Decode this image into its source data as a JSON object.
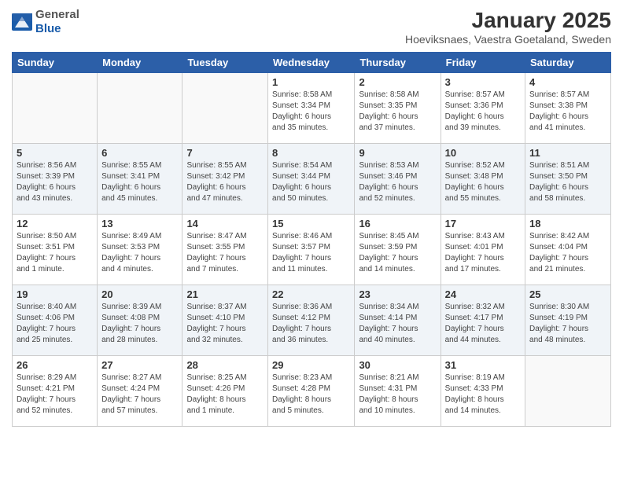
{
  "header": {
    "logo_general": "General",
    "logo_blue": "Blue",
    "title": "January 2025",
    "subtitle": "Hoeviksnaes, Vaestra Goetaland, Sweden"
  },
  "weekdays": [
    "Sunday",
    "Monday",
    "Tuesday",
    "Wednesday",
    "Thursday",
    "Friday",
    "Saturday"
  ],
  "weeks": [
    [
      {
        "day": "",
        "info": ""
      },
      {
        "day": "",
        "info": ""
      },
      {
        "day": "",
        "info": ""
      },
      {
        "day": "1",
        "info": "Sunrise: 8:58 AM\nSunset: 3:34 PM\nDaylight: 6 hours\nand 35 minutes."
      },
      {
        "day": "2",
        "info": "Sunrise: 8:58 AM\nSunset: 3:35 PM\nDaylight: 6 hours\nand 37 minutes."
      },
      {
        "day": "3",
        "info": "Sunrise: 8:57 AM\nSunset: 3:36 PM\nDaylight: 6 hours\nand 39 minutes."
      },
      {
        "day": "4",
        "info": "Sunrise: 8:57 AM\nSunset: 3:38 PM\nDaylight: 6 hours\nand 41 minutes."
      }
    ],
    [
      {
        "day": "5",
        "info": "Sunrise: 8:56 AM\nSunset: 3:39 PM\nDaylight: 6 hours\nand 43 minutes."
      },
      {
        "day": "6",
        "info": "Sunrise: 8:55 AM\nSunset: 3:41 PM\nDaylight: 6 hours\nand 45 minutes."
      },
      {
        "day": "7",
        "info": "Sunrise: 8:55 AM\nSunset: 3:42 PM\nDaylight: 6 hours\nand 47 minutes."
      },
      {
        "day": "8",
        "info": "Sunrise: 8:54 AM\nSunset: 3:44 PM\nDaylight: 6 hours\nand 50 minutes."
      },
      {
        "day": "9",
        "info": "Sunrise: 8:53 AM\nSunset: 3:46 PM\nDaylight: 6 hours\nand 52 minutes."
      },
      {
        "day": "10",
        "info": "Sunrise: 8:52 AM\nSunset: 3:48 PM\nDaylight: 6 hours\nand 55 minutes."
      },
      {
        "day": "11",
        "info": "Sunrise: 8:51 AM\nSunset: 3:50 PM\nDaylight: 6 hours\nand 58 minutes."
      }
    ],
    [
      {
        "day": "12",
        "info": "Sunrise: 8:50 AM\nSunset: 3:51 PM\nDaylight: 7 hours\nand 1 minute."
      },
      {
        "day": "13",
        "info": "Sunrise: 8:49 AM\nSunset: 3:53 PM\nDaylight: 7 hours\nand 4 minutes."
      },
      {
        "day": "14",
        "info": "Sunrise: 8:47 AM\nSunset: 3:55 PM\nDaylight: 7 hours\nand 7 minutes."
      },
      {
        "day": "15",
        "info": "Sunrise: 8:46 AM\nSunset: 3:57 PM\nDaylight: 7 hours\nand 11 minutes."
      },
      {
        "day": "16",
        "info": "Sunrise: 8:45 AM\nSunset: 3:59 PM\nDaylight: 7 hours\nand 14 minutes."
      },
      {
        "day": "17",
        "info": "Sunrise: 8:43 AM\nSunset: 4:01 PM\nDaylight: 7 hours\nand 17 minutes."
      },
      {
        "day": "18",
        "info": "Sunrise: 8:42 AM\nSunset: 4:04 PM\nDaylight: 7 hours\nand 21 minutes."
      }
    ],
    [
      {
        "day": "19",
        "info": "Sunrise: 8:40 AM\nSunset: 4:06 PM\nDaylight: 7 hours\nand 25 minutes."
      },
      {
        "day": "20",
        "info": "Sunrise: 8:39 AM\nSunset: 4:08 PM\nDaylight: 7 hours\nand 28 minutes."
      },
      {
        "day": "21",
        "info": "Sunrise: 8:37 AM\nSunset: 4:10 PM\nDaylight: 7 hours\nand 32 minutes."
      },
      {
        "day": "22",
        "info": "Sunrise: 8:36 AM\nSunset: 4:12 PM\nDaylight: 7 hours\nand 36 minutes."
      },
      {
        "day": "23",
        "info": "Sunrise: 8:34 AM\nSunset: 4:14 PM\nDaylight: 7 hours\nand 40 minutes."
      },
      {
        "day": "24",
        "info": "Sunrise: 8:32 AM\nSunset: 4:17 PM\nDaylight: 7 hours\nand 44 minutes."
      },
      {
        "day": "25",
        "info": "Sunrise: 8:30 AM\nSunset: 4:19 PM\nDaylight: 7 hours\nand 48 minutes."
      }
    ],
    [
      {
        "day": "26",
        "info": "Sunrise: 8:29 AM\nSunset: 4:21 PM\nDaylight: 7 hours\nand 52 minutes."
      },
      {
        "day": "27",
        "info": "Sunrise: 8:27 AM\nSunset: 4:24 PM\nDaylight: 7 hours\nand 57 minutes."
      },
      {
        "day": "28",
        "info": "Sunrise: 8:25 AM\nSunset: 4:26 PM\nDaylight: 8 hours\nand 1 minute."
      },
      {
        "day": "29",
        "info": "Sunrise: 8:23 AM\nSunset: 4:28 PM\nDaylight: 8 hours\nand 5 minutes."
      },
      {
        "day": "30",
        "info": "Sunrise: 8:21 AM\nSunset: 4:31 PM\nDaylight: 8 hours\nand 10 minutes."
      },
      {
        "day": "31",
        "info": "Sunrise: 8:19 AM\nSunset: 4:33 PM\nDaylight: 8 hours\nand 14 minutes."
      },
      {
        "day": "",
        "info": ""
      }
    ]
  ]
}
